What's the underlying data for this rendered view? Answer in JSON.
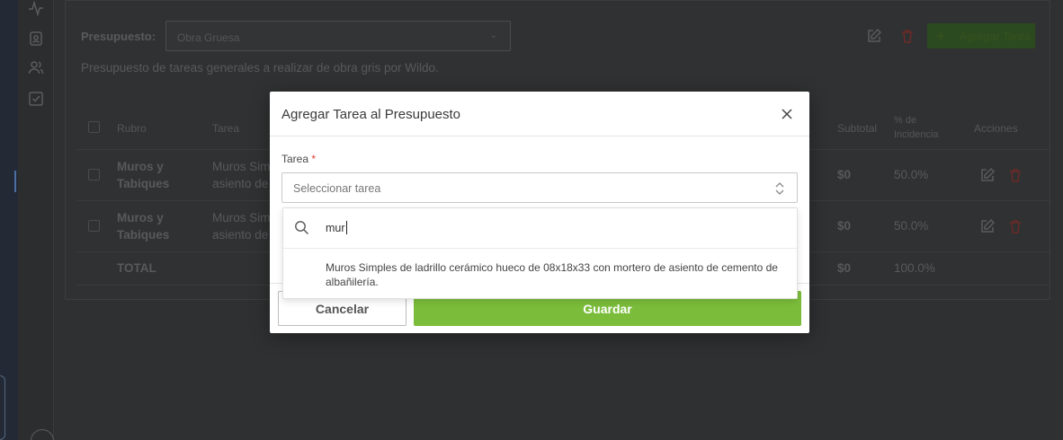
{
  "background": {
    "budget_label": "Presupuesto:",
    "budget_select_value": "Obra Gruesa",
    "description": "Presupuesto de tareas generales a realizar de obra gris por Wildo.",
    "add_task_label": "Agregar Tarea",
    "table": {
      "headers": {
        "rubro": "Rubro",
        "tarea": "Tarea",
        "subtotal": "Subtotal",
        "incidencia_line1": "% de",
        "incidencia_line2": "Incidencia",
        "acciones": "Acciones"
      },
      "rows": [
        {
          "rubro_l1": "Muros y",
          "rubro_l2": "Tabiques",
          "tarea_l1": "Muros Sim",
          "tarea_l2": "asiento de",
          "subtotal": "$0",
          "incidencia": "50.0%"
        },
        {
          "rubro_l1": "Muros y",
          "rubro_l2": "Tabiques",
          "tarea_l1": "Muros Sim",
          "tarea_l2": "asiento de",
          "subtotal": "$0",
          "incidencia": "50.0%"
        }
      ],
      "total": {
        "label": "TOTAL",
        "subtotal": "$0",
        "incidencia": "100.0%"
      }
    }
  },
  "modal": {
    "title": "Agregar Tarea al Presupuesto",
    "field_label": "Tarea",
    "required_mark": "*",
    "select_placeholder": "Seleccionar tarea",
    "search_value": "mur",
    "option": "Muros Simples de ladrillo cerámico hueco de 08x18x33 con mortero de asiento de cemento de albañilería.",
    "cancel_label": "Cancelar",
    "save_label": "Guardar"
  },
  "colors": {
    "accent_green": "#7bbd3b",
    "danger_red": "#e0403a",
    "backdrop": "#2f3031"
  },
  "icons": [
    "activity-icon",
    "contact-card-icon",
    "users-icon",
    "checklist-icon",
    "edit-icon",
    "trash-icon",
    "plus-icon",
    "close-icon",
    "search-icon",
    "updown-chevron-icon",
    "chevron-down-icon"
  ]
}
